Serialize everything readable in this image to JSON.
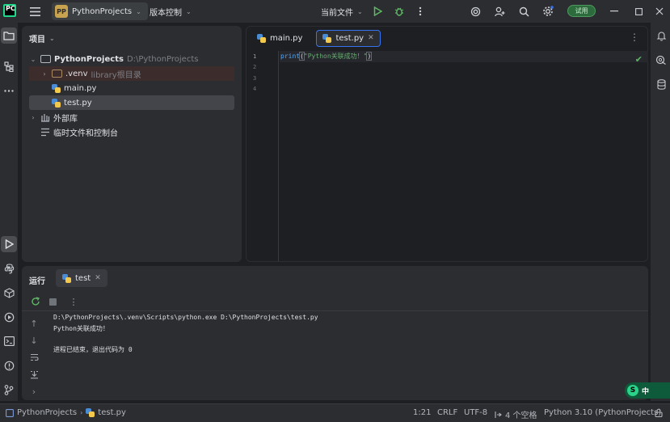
{
  "titlebar": {
    "project_badge": "PP",
    "project_name": "PythonProjects",
    "vcs_label": "版本控制",
    "run_config": "当前文件",
    "trial_label": "试用"
  },
  "project_panel": {
    "header": "项目",
    "tree": [
      {
        "label": "PythonProjects",
        "hint": "D:\\PythonProjects"
      },
      {
        "label": ".venv",
        "hint": "library根目录"
      },
      {
        "label": "main.py",
        "hint": ""
      },
      {
        "label": "test.py",
        "hint": ""
      },
      {
        "label": "外部库",
        "hint": ""
      },
      {
        "label": "临时文件和控制台",
        "hint": ""
      }
    ]
  },
  "editor": {
    "tabs": [
      {
        "label": "main.py"
      },
      {
        "label": "test.py"
      }
    ],
    "line_numbers": [
      "1",
      "2",
      "3",
      "4"
    ],
    "code": {
      "func": "print",
      "open": "(",
      "string": "\"Python关联成功！\"",
      "close": ")"
    }
  },
  "run_panel": {
    "title": "运行",
    "tab_label": "test",
    "console": [
      "D:\\PythonProjects\\.venv\\Scripts\\python.exe D:\\PythonProjects\\test.py",
      "Python关联成功！",
      "进程已结束，退出代码为 0"
    ]
  },
  "statusbar": {
    "breadcrumb_project": "PythonProjects",
    "breadcrumb_file": "test.py",
    "position": "1:21",
    "line_ending": "CRLF",
    "encoding": "UTF-8",
    "indent": "4 个空格",
    "interpreter": "Python 3.10 (PythonProjects)"
  },
  "ime": {
    "badge": "S",
    "lang": "中"
  },
  "colors": {
    "accent": "#3574f0",
    "run_green": "#5fb865",
    "panel_bg": "#2b2d30",
    "editor_bg": "#1e1f22"
  }
}
